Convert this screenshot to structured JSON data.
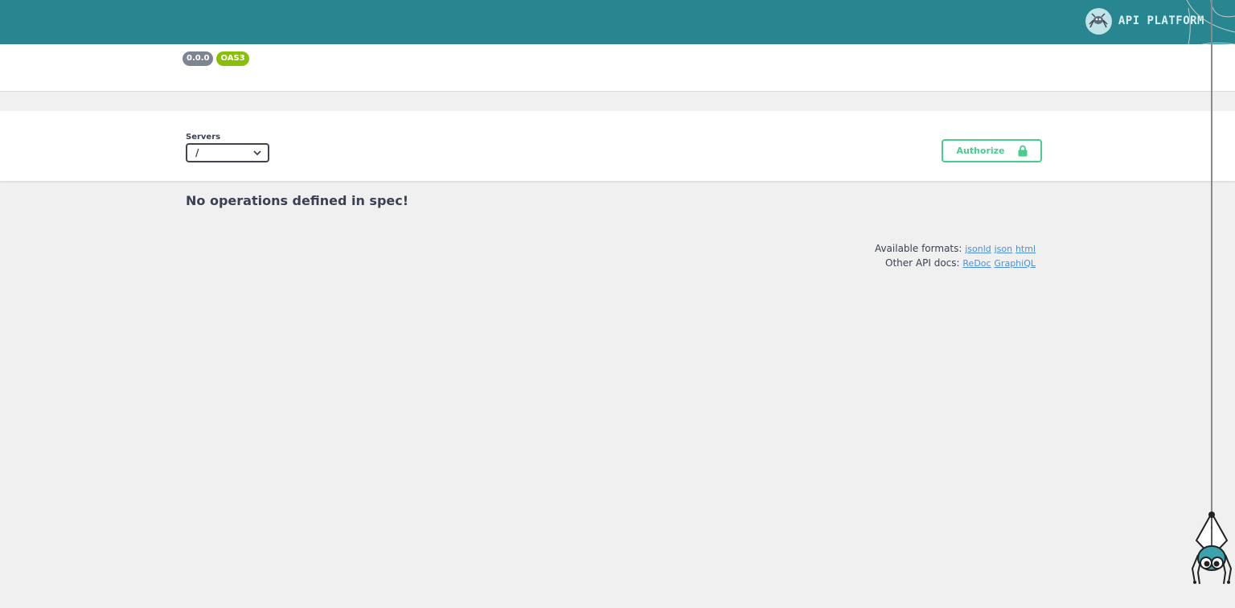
{
  "header": {
    "brand_text": "API PLATFORM",
    "logo_icon": "spider-logo-icon",
    "background_color": "#288690"
  },
  "info": {
    "version_badge": "0.0.0",
    "spec_badge": "OAS3"
  },
  "servers": {
    "label": "Servers",
    "selected": "/"
  },
  "authorize": {
    "label": "Authorize",
    "icon": "lock-icon",
    "color": "#49cc90"
  },
  "main": {
    "message": "No operations defined in spec!"
  },
  "footer": {
    "formats_label": "Available formats:",
    "formats": [
      "jsonld",
      "json",
      "html"
    ],
    "docs_label": "Other API docs:",
    "docs": [
      "ReDoc",
      "GraphiQL"
    ]
  }
}
